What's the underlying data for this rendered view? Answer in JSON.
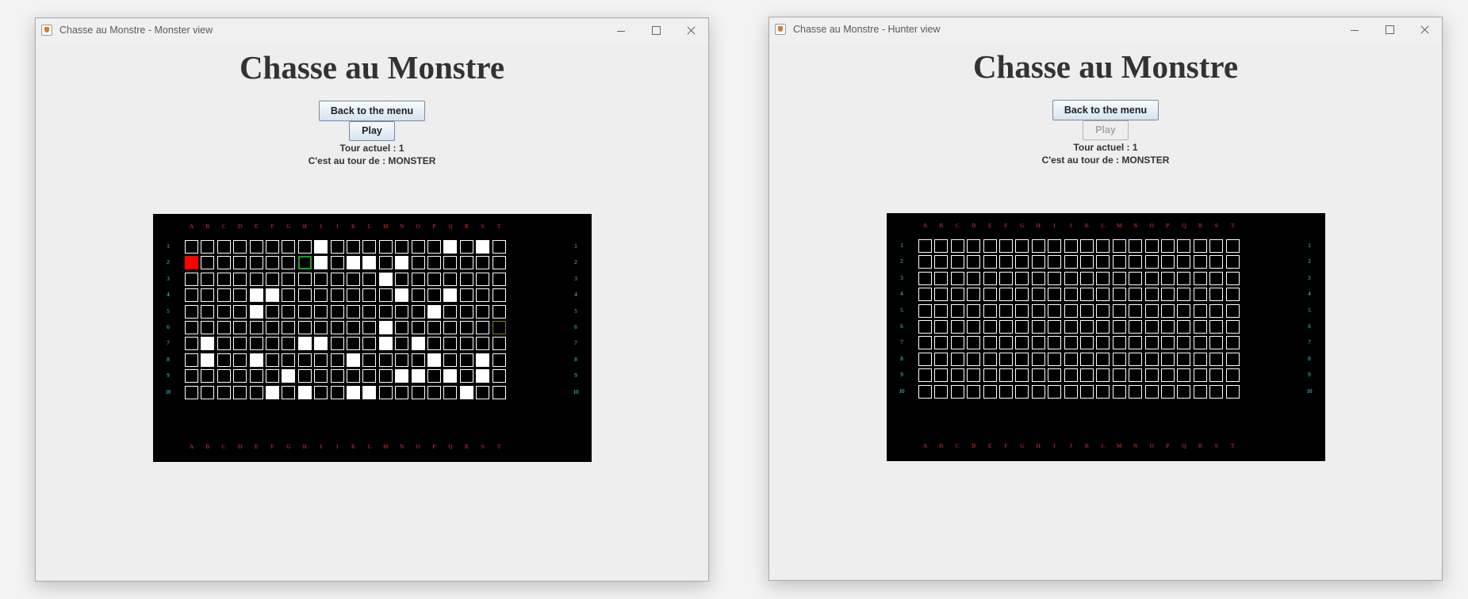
{
  "windows": [
    {
      "id": "monster",
      "title": "Chasse au Monstre - Monster view",
      "game_title": "Chasse au Monstre",
      "back_button": "Back to the menu",
      "play_button": "Play",
      "play_enabled": true,
      "tour_label": "Tour actuel : 1",
      "turn_label": "C'est au tour de : MONSTER",
      "board": {
        "columns": [
          "A",
          "B",
          "C",
          "D",
          "E",
          "F",
          "G",
          "H",
          "I",
          "J",
          "K",
          "L",
          "M",
          "N",
          "O",
          "P",
          "Q",
          "R",
          "S",
          "T"
        ],
        "rows": [
          "1",
          "2",
          "3",
          "4",
          "5",
          "6",
          "7",
          "8",
          "9",
          "10"
        ],
        "cells": [
          "........W.......W.W..",
          "R......GW.WW.W......",
          "............W.......",
          "....WW.......W..W...",
          "....W..........W....",
          "............W......Y",
          ".W.....WW...W.W.....",
          ".W..W.....W....W..W.",
          "......W......WW.W.W..",
          ".....W.W..WW.....W.."
        ]
      }
    },
    {
      "id": "hunter",
      "title": "Chasse au Monstre - Hunter view",
      "game_title": "Chasse au Monstre",
      "back_button": "Back to the menu",
      "play_button": "Play",
      "play_enabled": false,
      "tour_label": "Tour actuel : 1",
      "turn_label": "C'est au tour de : MONSTER",
      "board": {
        "columns": [
          "A",
          "B",
          "C",
          "D",
          "E",
          "F",
          "G",
          "H",
          "I",
          "J",
          "K",
          "L",
          "M",
          "N",
          "O",
          "P",
          "Q",
          "R",
          "S",
          "T"
        ],
        "rows": [
          "1",
          "2",
          "3",
          "4",
          "5",
          "6",
          "7",
          "8",
          "9",
          "10"
        ],
        "cells": [
          "....................",
          "....................",
          "....................",
          "....................",
          "....................",
          "....................",
          "....................",
          "....................",
          "....................",
          "...................."
        ]
      }
    }
  ],
  "cell_legend": {
    ".": "empty",
    "W": "white",
    "R": "monster-red",
    "G": "green-outline",
    "Y": "yellow-outline"
  }
}
